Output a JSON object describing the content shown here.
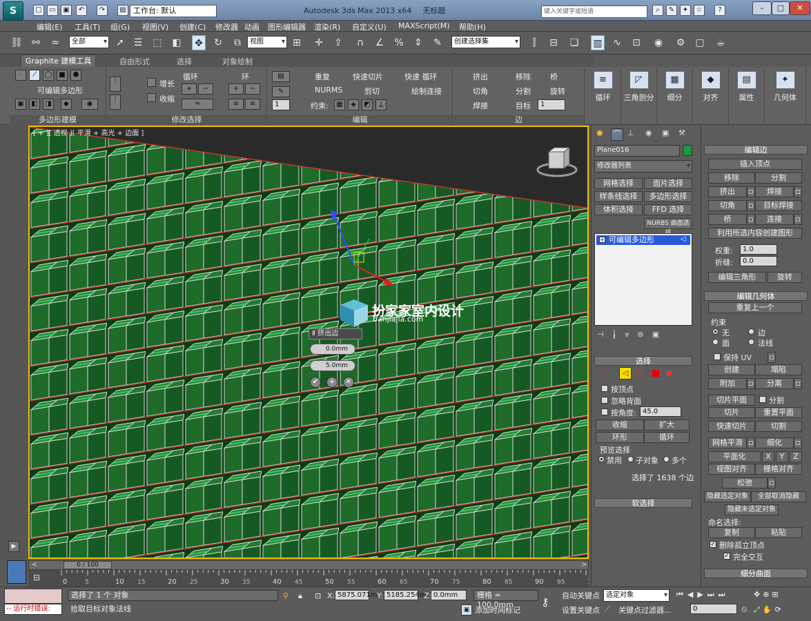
{
  "app": {
    "title": "Autodesk 3ds Max  2013 x64",
    "doc": "无标题",
    "workspace": "工作台: 默认",
    "search_placeholder": "键入关键字或短语",
    "logo": "S"
  },
  "menu": [
    "编辑(E)",
    "工具(T)",
    "组(G)",
    "视图(V)",
    "创建(C)",
    "修改器",
    "动画",
    "图形编辑器",
    "渲染(R)",
    "自定义(U)",
    "MAXScript(M)",
    "帮助(H)"
  ],
  "toolbar": {
    "filter": "全部",
    "refcoord": "视图",
    "selset": "创建选择集"
  },
  "ribbon": {
    "tabs": [
      "Graphite 建模工具",
      "自由形式",
      "选择",
      "对象绘制"
    ],
    "groups": {
      "poly": "多边形建模",
      "polyname": "可编辑多边形",
      "modsel": "修改选择",
      "grow": "增长",
      "shrink": "收缩",
      "loop": "循环",
      "ring": "环",
      "edit": "编辑",
      "edge": "边"
    },
    "edit_items": [
      "重复",
      "快速切片",
      "NURMS",
      "剪切",
      "快速 循环",
      "绘制连接",
      "约束:"
    ],
    "edge_items": [
      "挤出",
      "移除",
      "桥",
      "切角",
      "分割",
      "旋转",
      "焊接",
      "目标"
    ],
    "big": [
      "循环",
      "三角剖分",
      "细分",
      "对齐",
      "属性",
      "几何体"
    ]
  },
  "viewport": {
    "label": "[ + ][ 透视 ][ 平滑 + 高光 + 边面 ]",
    "watermark_title": "扮家家室内设计",
    "watermark_url": "banjiajia.com",
    "caddy_title": "挤出边",
    "caddy_height": "0.0mm",
    "caddy_width": "5.0mm"
  },
  "timeline": {
    "frame": "0 / 100",
    "ticks": [
      "0",
      "10",
      "20",
      "30",
      "40",
      "50",
      "60",
      "70",
      "80",
      "90",
      "100"
    ],
    "ticks_minor": [
      "5",
      "15",
      "25",
      "35",
      "45",
      "55",
      "65",
      "75",
      "85",
      "95"
    ]
  },
  "status": {
    "selected": "选择了 1 个 对象",
    "prompt": "拾取目标对象法线",
    "error": "-- 运行时错误:",
    "x": "5875.071m",
    "y": "5185.254m",
    "z": "0.0mm",
    "grid": "栅格 = 100.0mm",
    "autokey": "自动关键点",
    "setkey": "设置关键点",
    "addtime": "添加时间标记",
    "selobj": "选定对象",
    "keyfilter": "关键点过滤器...",
    "frameinput": "0"
  },
  "cmdpanel": {
    "objname": "Plane016",
    "modlist": "修改器列表",
    "modbtns": [
      "网格选择",
      "面片选择",
      "样条线选择",
      "多边形选择",
      "体积选择",
      "FFD 选择",
      "NURBS 曲面选择"
    ],
    "stack_item": "可编辑多边形",
    "sel_header": "选择",
    "by_vertex": "按顶点",
    "ignore_back": "忽略背面",
    "by_angle": "按角度:",
    "angle": "45.0",
    "shrink": "收缩",
    "grow": "扩大",
    "ring": "环形",
    "loop": "循环",
    "preview": "预览选择",
    "disable": "禁用",
    "subobj": "子对象",
    "multi": "多个",
    "selcount": "选择了 1638 个边",
    "softsel": "软选择"
  },
  "editpanel": {
    "edit_edges": "编辑边",
    "insert_vertex": "插入顶点",
    "remove": "移除",
    "split": "分割",
    "extrude": "挤出",
    "weld": "焊接",
    "chamfer": "切角",
    "target_weld": "目标焊接",
    "bridge": "桥",
    "connect": "连接",
    "create_shape": "利用所选内容创建图形",
    "weight": "权重:",
    "weight_val": "1.0",
    "crease": "折缝:",
    "crease_val": "0.0",
    "edit_tri": "编辑三角形",
    "turn": "旋转",
    "edit_geo": "编辑几何体",
    "repeat_last": "重复上一个",
    "constraints": "约束",
    "c_none": "无",
    "c_edge": "边",
    "c_face": "面",
    "c_normal": "法线",
    "keep_uv": "保持 UV",
    "create": "创建",
    "collapse": "塌陷",
    "attach": "附加",
    "detach": "分离",
    "slice_plane": "切片平面",
    "split2": "分割",
    "slice": "切片",
    "reset_plane": "重置平面",
    "quickslice": "快速切片",
    "cut": "切割",
    "meshsmooth": "网格平滑",
    "tessellate": "细化",
    "planarize": "平面化",
    "x": "X",
    "y": "Y",
    "z": "Z",
    "view_align": "视图对齐",
    "grid_align": "栅格对齐",
    "relax": "松弛",
    "hide_sel": "隐藏选定对象",
    "unhide_all": "全部取消隐藏",
    "hide_unsel": "隐藏未选定对象",
    "named_sel": "命名选择:",
    "copy": "复制",
    "paste": "粘贴",
    "del_iso": "删除孤立顶点",
    "full_interact": "完全交互",
    "subdiv": "细分曲面"
  },
  "colors": {
    "viewport_border": "#f0c000",
    "mesh_green": "#1f6b2a",
    "objcolor": "#1a9a3a"
  }
}
